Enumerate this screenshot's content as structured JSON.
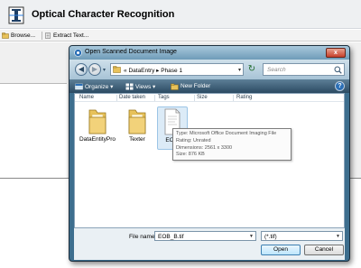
{
  "app": {
    "title": "Optical Character Recognition",
    "toolbar": {
      "browse_label": "Browse...",
      "extract_label": "Extract Text..."
    }
  },
  "dialog": {
    "title": "Open Scanned Document Image",
    "close_label": "x",
    "address": {
      "prefix": "«",
      "crumbs": [
        "DataEntry",
        "Phase 1"
      ],
      "separator": "▸"
    },
    "search_placeholder": "Search",
    "commands": {
      "organize_label": "Organize ▾",
      "views_label": "Views ▾",
      "new_folder_label": "New Folder"
    },
    "help_label": "?",
    "columns": [
      "Name",
      "Date taken",
      "Tags",
      "Size",
      "Rating"
    ],
    "files": [
      {
        "name": "DataEntityPro",
        "type": "folder"
      },
      {
        "name": "Texter",
        "type": "folder"
      },
      {
        "name": "EOB_",
        "type": "document"
      }
    ],
    "tooltip": {
      "line1": "Type: Microsoft Office Document Imaging File",
      "line2": "Rating: Unrated",
      "line3": "Dimensions: 2561 x 3300",
      "line4": "Size: 876 KB"
    },
    "filename_label": "File name:",
    "filename_value": "EOB_B.tif",
    "filetype_value": "(*.tif)",
    "open_label": "Open",
    "cancel_label": "Cancel"
  },
  "colors": {
    "dialog_frame": "#3d6e8e",
    "command_bar": "#2b4a62",
    "selection": "#dcebf7",
    "folder": "#e8c25a"
  }
}
